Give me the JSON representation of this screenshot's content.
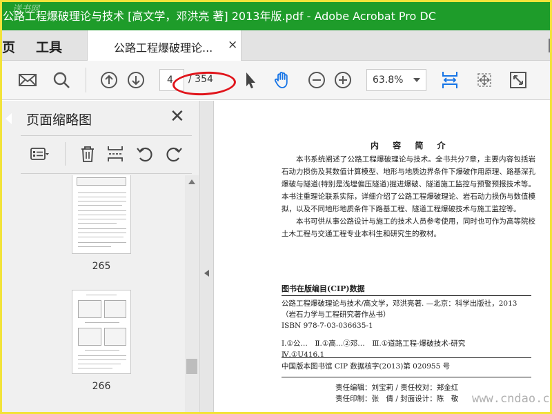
{
  "window": {
    "title": "公路工程爆破理论与技术 [高文学，邓洪亮 著] 2013年版.pdf - Adobe Acrobat Pro DC",
    "title_watermark": "送书网"
  },
  "tabs": {
    "home_label": "页",
    "tools_label": "工具",
    "document_tab_label": "公路工程爆破理论...",
    "close_glyph": "×"
  },
  "toolbar": {
    "current_page": "4",
    "total_pages": "/ 354",
    "zoom": "63.8%"
  },
  "icons": {
    "mail": "envelope-icon",
    "search": "magnifier-icon",
    "prev": "arrow-up-circle-icon",
    "next": "arrow-down-circle-icon",
    "select": "cursor-arrow-icon",
    "hand": "hand-icon",
    "zoom_out": "minus-circle-icon",
    "zoom_in": "plus-circle-icon",
    "fit": "fit-width-icon",
    "scroll_mode": "scroll-mode-icon",
    "fullscreen": "fullscreen-icon",
    "more": "more-icon"
  },
  "colors": {
    "titlebar": "#1e9c2a",
    "accent": "#1473e6",
    "annotation": "#e0141b",
    "frame": "#f2e33a"
  },
  "sidepanel": {
    "title": "页面缩略图",
    "close_glyph": "✕",
    "thumbnails": [
      {
        "label": "265"
      },
      {
        "label": "266"
      }
    ]
  },
  "document": {
    "heading": "内 容 简 介",
    "intro_paragraphs": [
      "本书系统阐述了公路工程爆破理论与技术。全书共分7章，主要内容包括岩石动力损伤及其数值计算模型、地形与地质边界条件下爆破作用原理、路基深孔爆破与隧道(特别是浅埋偏压隧道)掘进爆破、隧道施工监控与预警预报技术等。本书注重理论联系实际，详细介绍了公路工程爆破理论、岩石动力损伤与数值模拟，以及不同地形地质条件下路基工程、隧道工程爆破技术与施工监控等。",
      "本书可供从事公路设计与施工的技术人员参考使用，同时也可作为高等院校土木工程与交通工程专业本科生和研究生的教材。"
    ],
    "cip_title": "图书在版编目(CIP)数据",
    "cip_lines": [
      "公路工程爆破理论与技术/高文学，邓洪亮著. —北京：科学出版社，2013",
      "（岩石力学与工程研究著作丛书）",
      "ISBN 978-7-03-036635-1",
      "",
      "Ⅰ.①公…　Ⅱ.①高…②邓…　Ⅲ.①道路工程-爆破技术-研究",
      "Ⅳ.①U416.1"
    ],
    "cip_number": "中国版本图书馆 CIP 数据核字(2013)第 020955 号",
    "credit_lines": [
      "责任编辑：刘宝莉 / 责任校对：郑金红",
      "责任印制：张　倩 / 封面设计：陈　敬"
    ]
  },
  "watermark": "www.cndao.com"
}
